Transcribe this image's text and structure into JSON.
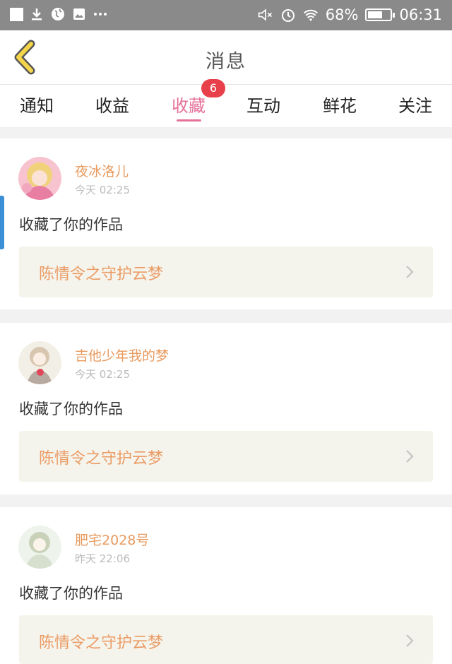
{
  "status_bar": {
    "battery_percent": "68%",
    "battery_level": 0.68,
    "time": "06:31",
    "icons_left": [
      "notification-square-icon",
      "download-icon",
      "globe-icon",
      "image-icon",
      "more-dots-icon"
    ],
    "icons_right": [
      "mute-icon",
      "alarm-icon",
      "wifi-icon",
      "battery-icon"
    ]
  },
  "header": {
    "title": "消息"
  },
  "tabs": [
    {
      "label": "通知",
      "active": false
    },
    {
      "label": "收益",
      "active": false
    },
    {
      "label": "收藏",
      "active": true,
      "badge": "6"
    },
    {
      "label": "互动",
      "active": false
    },
    {
      "label": "鲜花",
      "active": false
    },
    {
      "label": "关注",
      "active": false
    }
  ],
  "notifications": [
    {
      "user": "夜冰洛儿",
      "time": "今天 02:25",
      "action": "收藏了你的作品",
      "work_title": "陈情令之守护云梦"
    },
    {
      "user": "吉他少年我的梦",
      "time": "今天 02:25",
      "action": "收藏了你的作品",
      "work_title": "陈情令之守护云梦"
    },
    {
      "user": "肥宅2028号",
      "time": "昨天 22:06",
      "action": "收藏了你的作品",
      "work_title": "陈情令之守护云梦"
    }
  ],
  "colors": {
    "accent_pink": "#e5719a",
    "username_orange": "#e89a5e",
    "badge_red": "#e8404a",
    "back_arrow_yellow": "#f3d44a"
  }
}
